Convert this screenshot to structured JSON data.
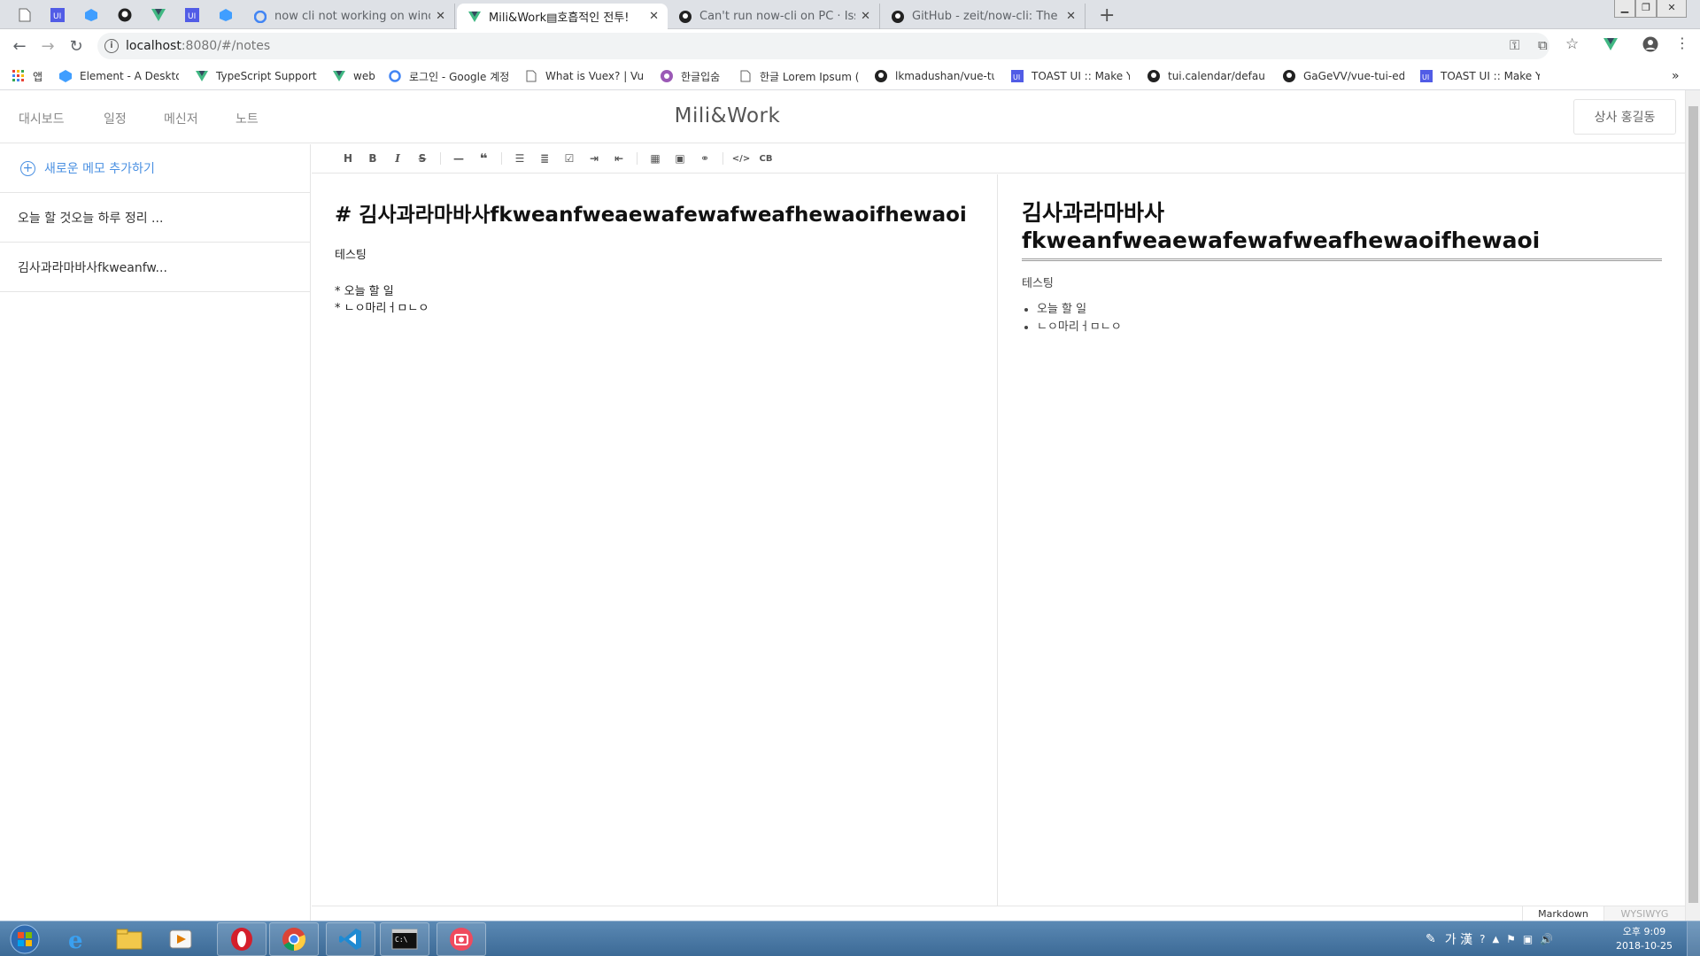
{
  "browser": {
    "pinned_tabs": [
      "page-icon",
      "toast-ui-icon",
      "element-icon",
      "github-icon",
      "vue-icon",
      "toast-ui-icon",
      "element-icon"
    ],
    "tabs": [
      {
        "title": "now cli not working on window",
        "icon": "google-icon"
      },
      {
        "title": "Mili&Work▤호흡적인 전투!",
        "icon": "vue-icon"
      },
      {
        "title": "Can't run now-cli on PC · Issue",
        "icon": "github-icon"
      },
      {
        "title": "GitHub - zeit/now-cli: The comm",
        "icon": "github-icon"
      }
    ],
    "url_host": "localhost",
    "url_path": ":8080/#/notes",
    "bookmarks": [
      {
        "label": "앱",
        "icon": "apps-grid-icon"
      },
      {
        "label": "Element - A Desktop",
        "icon": "element-icon"
      },
      {
        "label": "TypeScript Support",
        "icon": "vue-icon"
      },
      {
        "label": "web",
        "icon": "vue-icon"
      },
      {
        "label": "로그인 - Google 계정",
        "icon": "google-icon"
      },
      {
        "label": "What is Vuex? | Vue",
        "icon": "page-icon"
      },
      {
        "label": "한글입숨",
        "icon": "hangul-icon"
      },
      {
        "label": "한글 Lorem Ipsum (",
        "icon": "page-icon"
      },
      {
        "label": "lkmadushan/vue-tui",
        "icon": "github-icon"
      },
      {
        "label": "TOAST UI :: Make Yo",
        "icon": "toast-ui-icon"
      },
      {
        "label": "tui.calendar/default.j",
        "icon": "github-icon"
      },
      {
        "label": "GaGeVV/vue-tui-edit",
        "icon": "github-icon"
      },
      {
        "label": "TOAST UI :: Make Yo",
        "icon": "toast-ui-icon"
      }
    ]
  },
  "app": {
    "nav": [
      "대시보드",
      "일정",
      "메신저",
      "노트"
    ],
    "brand": "Mili&Work",
    "user_button": "상사 홍길동",
    "add_memo": "새로운 메모 추가하기",
    "memos": [
      "오늘 할 것오늘 하루 정리 ...",
      "김사과라마바사fkweanfw..."
    ]
  },
  "editor": {
    "toolbar": [
      "heading-icon",
      "bold-icon",
      "italic-icon",
      "strike-icon",
      "|",
      "hr-icon",
      "quote-icon",
      "|",
      "bullet-list-icon",
      "ordered-list-icon",
      "task-icon",
      "indent-icon",
      "outdent-icon",
      "|",
      "table-icon",
      "image-icon",
      "link-icon",
      "|",
      "code-icon",
      "codeblock-icon"
    ],
    "markdown": {
      "heading": "# 김사과라마바사fkweanfweaewafewafweafhewaoifhewaoi",
      "paragraph": "테스팅",
      "items": [
        "* 오늘 할 일",
        "* ㄴㅇ마리ㅓㅁㄴㅇ"
      ]
    },
    "preview": {
      "heading": "김사과라마바사fkweanfweaewafewafweafhewaoifhewaoi",
      "paragraph": "테스팅",
      "items": [
        "오늘 할 일",
        "ㄴㅇ마리ㅓㅁㄴㅇ"
      ]
    },
    "modes": {
      "markdown": "Markdown",
      "wysiwyg": "WYSIWYG",
      "active": "Markdown"
    }
  },
  "taskbar": {
    "apps": [
      "ie-icon",
      "explorer-icon",
      "media-player-icon",
      "opera-icon",
      "chrome-icon",
      "vscode-icon",
      "cmd-icon",
      "camera-icon"
    ],
    "ime": "가 漢",
    "clock_time": "오후 9:09",
    "clock_date": "2018-10-25"
  }
}
